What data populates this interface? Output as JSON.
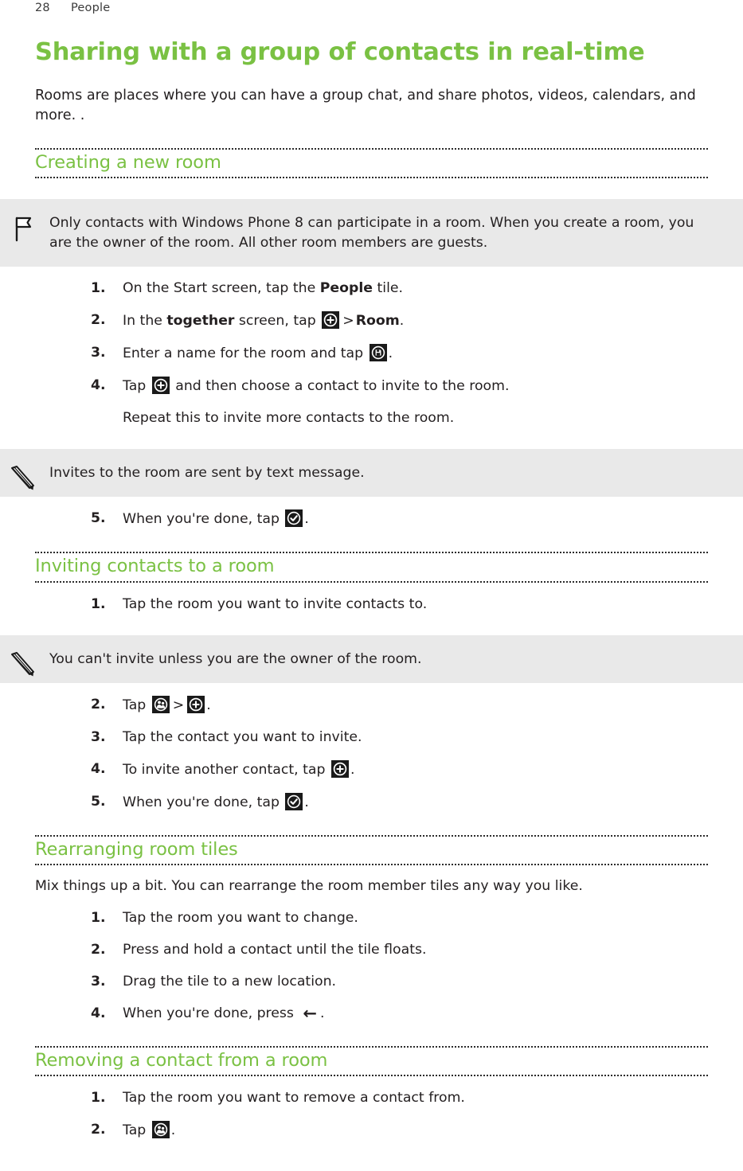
{
  "header": {
    "page_number": "28",
    "chapter": "People"
  },
  "colors": {
    "accent_green": "#7ac143",
    "callout_bg": "#e9e9e9",
    "text": "#231f20",
    "key_bg": "#1a1a1a"
  },
  "title": "Sharing with a group of contacts in real-time",
  "intro": "Rooms are places where you can have a group chat, and share photos, videos, calendars, and more. .",
  "sections": [
    {
      "heading": "Creating a new room",
      "note": {
        "icon": "flag-icon",
        "text": "Only contacts with Windows Phone 8 can participate in a room. When you create a room, you are the owner of the room. All other room members are guests."
      },
      "steps_a": [
        {
          "num": "1.",
          "pre": "On the Start screen, tap the ",
          "bold": "People",
          "post": " tile."
        },
        {
          "num": "2.",
          "pre": "In the ",
          "bold": "together",
          "mid": " screen, tap ",
          "icon1": "plus-icon",
          "sep": ">",
          "bold2": "Room",
          "post": "."
        },
        {
          "num": "3.",
          "pre": "Enter a name for the room and tap ",
          "icon1": "save-icon",
          "post": "."
        },
        {
          "num": "4.",
          "pre": "Tap ",
          "icon1": "plus-icon",
          "post": " and then choose a contact to invite to the room.",
          "sub": "Repeat this to invite more contacts to the room."
        }
      ],
      "tip": {
        "icon": "pencil-icon",
        "text": "Invites to the room are sent by text message."
      },
      "steps_b": [
        {
          "num": "5.",
          "pre": "When you're done, tap ",
          "icon1": "check-icon",
          "post": "."
        }
      ]
    },
    {
      "heading": "Inviting contacts to a room",
      "steps_a": [
        {
          "num": "1.",
          "pre": "Tap the room you want to invite contacts to."
        }
      ],
      "tip": {
        "icon": "pencil-icon",
        "text": "You can't invite unless you are the owner of the room."
      },
      "steps_b": [
        {
          "num": "2.",
          "pre": "Tap ",
          "icon1": "people-icon",
          "sep": ">",
          "icon2": "plus-icon",
          "post": "."
        },
        {
          "num": "3.",
          "pre": "Tap the contact you want to invite."
        },
        {
          "num": "4.",
          "pre": "To invite another contact, tap ",
          "icon1": "plus-icon",
          "post": "."
        },
        {
          "num": "5.",
          "pre": "When you're done, tap ",
          "icon1": "check-icon",
          "post": "."
        }
      ]
    },
    {
      "heading": "Rearranging room tiles",
      "lead": "Mix things up a bit. You can rearrange the room member tiles any way you like.",
      "steps_a": [
        {
          "num": "1.",
          "pre": "Tap the room you want to change."
        },
        {
          "num": "2.",
          "pre": "Press and hold a contact until the tile floats."
        },
        {
          "num": "3.",
          "pre": "Drag the tile to a new location."
        },
        {
          "num": "4.",
          "pre": "When you're done, press ",
          "arrow": "←",
          "post": "."
        }
      ]
    },
    {
      "heading": "Removing a contact from a room",
      "steps_a": [
        {
          "num": "1.",
          "pre": "Tap the room you want to remove a contact from."
        },
        {
          "num": "2.",
          "pre": "Tap ",
          "icon1": "people-icon",
          "post": "."
        }
      ]
    }
  ]
}
